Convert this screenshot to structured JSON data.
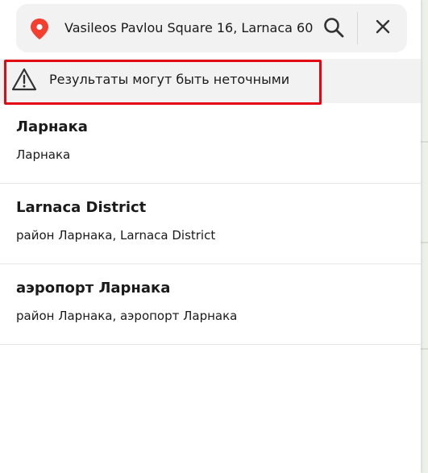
{
  "search": {
    "value": "Vasileos Pavlou Square 16, Larnaca 60"
  },
  "warning": {
    "text": "Результаты могут быть неточными"
  },
  "results": [
    {
      "title": "Ларнака",
      "subtitle": "Ларнака"
    },
    {
      "title": "Larnaca District",
      "subtitle": "район Ларнака, Larnaca District"
    },
    {
      "title": "аэропорт Ларнака",
      "subtitle": "район Ларнака, аэропорт Ларнака"
    }
  ],
  "icons": {
    "location": "map-pin-icon",
    "search": "search-icon",
    "close": "close-icon",
    "warning": "warning-triangle-icon"
  },
  "colors": {
    "pin": "#f43f2f",
    "highlight_border": "#e30613",
    "search_background": "#f2f2f2"
  }
}
